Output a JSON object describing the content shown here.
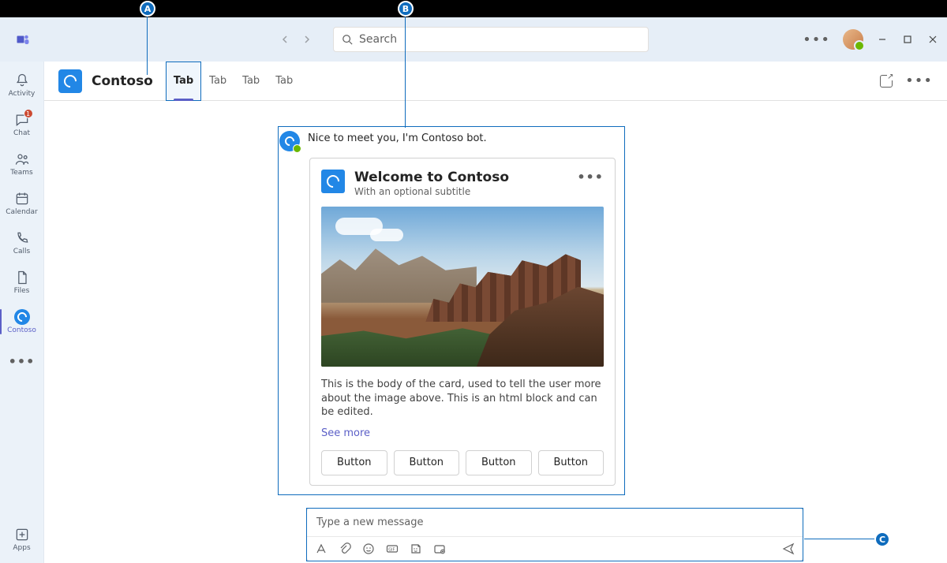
{
  "annotations": {
    "a": "A",
    "b": "B",
    "c": "C"
  },
  "titlebar": {
    "search_placeholder": "Search"
  },
  "rail": {
    "activity": "Activity",
    "chat": "Chat",
    "chat_badge": "1",
    "teams": "Teams",
    "calendar": "Calendar",
    "calls": "Calls",
    "files": "Files",
    "contoso": "Contoso",
    "apps": "Apps"
  },
  "app": {
    "title": "Contoso",
    "tabs": [
      "Tab",
      "Tab",
      "Tab",
      "Tab"
    ]
  },
  "bot": {
    "intro": "Nice to meet you, I'm Contoso bot.",
    "card": {
      "title": "Welcome to Contoso",
      "subtitle": "With an optional subtitle",
      "body": "This is the body of the card, used to tell the user more about the image above. This is an html block and can be edited.",
      "see_more": "See more",
      "buttons": [
        "Button",
        "Button",
        "Button",
        "Button"
      ]
    }
  },
  "compose": {
    "placeholder": "Type a new message"
  }
}
